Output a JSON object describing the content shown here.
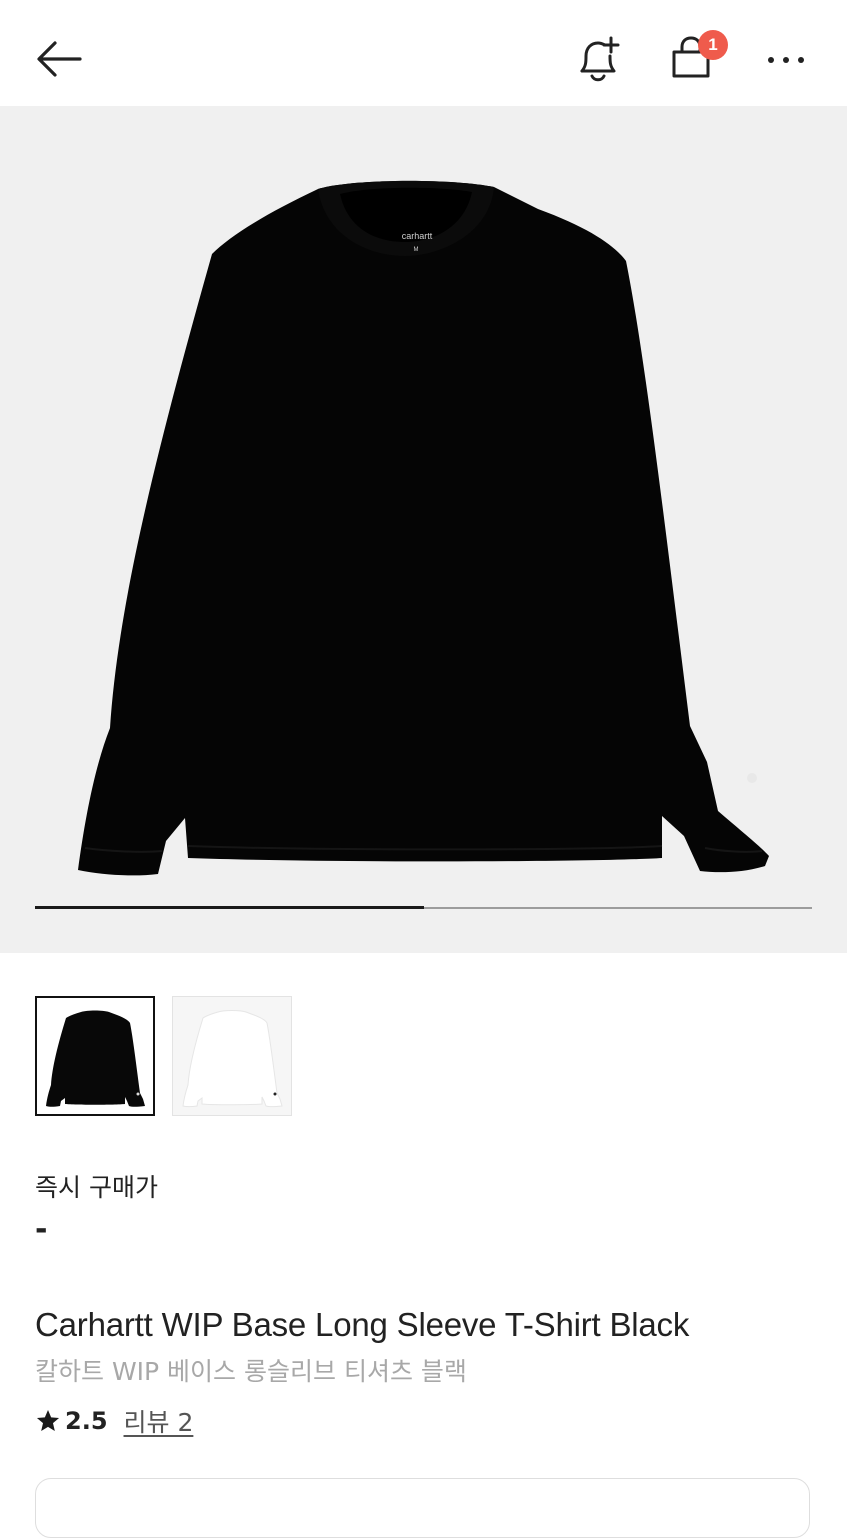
{
  "header": {
    "back_icon": "arrow-left-icon",
    "alert_icon": "bell-plus-icon",
    "cart_icon": "shopping-bag-icon",
    "cart_badge": "1",
    "more_icon": "more-dots-icon",
    "badge_color": "#ef5b4c"
  },
  "gallery": {
    "main_image": "black long sleeve t-shirt",
    "progress": 0.5,
    "thumbnails": [
      {
        "color": "black",
        "selected": true
      },
      {
        "color": "white",
        "selected": false
      }
    ]
  },
  "purchase": {
    "label": "즉시 구매가",
    "value": "-"
  },
  "product": {
    "name_en": "Carhartt WIP Base Long Sleeve T-Shirt Black",
    "name_ko": "칼하트 WIP 베이스 롱슬리브 티셔츠 블랙",
    "rating": "2.5",
    "reviews_label": "리뷰 2"
  }
}
